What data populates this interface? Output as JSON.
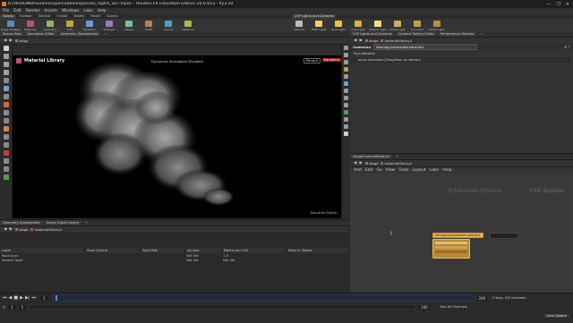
{
  "window": {
    "title": "D:/HOUDINI/Houdini/supercoded/explosion_fxptnl_v07.hipnc - Houdini FX Education Edition 20.0.653 - Py3.10",
    "controls": [
      "—",
      "❐",
      "✕"
    ]
  },
  "menu": [
    "File",
    "Edit",
    "Render",
    "Assets",
    "Windows",
    "Labs",
    "Help"
  ],
  "shelf_left": {
    "tabs": [
      "Solaris",
      "Sidebar",
      "Sidebar",
      "Create",
      "Modify",
      "Model",
      "Solaris"
    ],
    "tools": [
      "Stage Manager",
      "Materials",
      "Geometry",
      "Edit",
      "Transform",
      "Sublayer",
      "Merge",
      "Graft",
      "Layout",
      "Instancer"
    ]
  },
  "shelf_right": {
    "tabs": [
      "LOP Lights and Cameras"
    ],
    "tools": [
      "Camera",
      "Point Light",
      "Spot Light",
      "Area Light",
      "Distant Light",
      "Dome Light",
      "Env Light",
      "Portal Light"
    ]
  },
  "viewer_tabs": [
    "Scene View",
    "Animation Editor",
    "Geometry Spreadsheet"
  ],
  "viewer_path": {
    "context": "stage",
    "node": ""
  },
  "viewport": {
    "title": "Material Library",
    "status": "Dynamics Simulation Disabled",
    "persp": "Persp ▾",
    "cam": "No cam ▾",
    "edition": "Education Edition"
  },
  "spread_tabs": [
    "Geometry Spreadsheet",
    "Scene Graph Layers"
  ],
  "spread_path": {
    "context": "stage",
    "node": "materiallibrary4"
  },
  "layers": {
    "headers": [
      "Layer",
      "Save Control",
      "Save Path",
      "Up Axis",
      "Meters per Unit",
      "Mute in Viewer"
    ],
    "rows": [
      [
        "Root layer",
        "",
        "",
        "Not Set",
        "1.0",
        ""
      ],
      [
        "Session layer",
        "",
        "",
        "Not Set",
        "Not Set",
        ""
      ]
    ]
  },
  "params_tabs": [
    "LOP Lights and Cameras",
    "Content Gallery Editor",
    "Performance Monitor"
  ],
  "params_path": {
    "context": "stage",
    "node": "materiallibrary4"
  },
  "params": {
    "node_type": "Submenu",
    "node_name": "karmapyroomsakematerial1",
    "section": "Pyro Material",
    "input_operators": "Input Operators [Drag/Drop to reorder]"
  },
  "network_tabs": [
    "/stage/materiallibrary4",
    "+"
  ],
  "network_path": {
    "context": "stage",
    "node": "materiallibrary4"
  },
  "network_menu": [
    "Add",
    "Edit",
    "Go",
    "View",
    "Tools",
    "Layout",
    "Labs",
    "Help"
  ],
  "network": {
    "watermark_left": "Education Edition",
    "watermark_right": "VEX Builder",
    "node_label": "karmapyroomsakematerial1"
  },
  "timeline": {
    "start": "1",
    "frame": "1",
    "end": "240",
    "end2": "240",
    "keys": "0 keys, 0/0 channels",
    "key_all": "Key All Channels",
    "auto_update": "Auto Update"
  },
  "colors": {
    "accent": "#e8771e",
    "selection": "#f0b64a"
  }
}
